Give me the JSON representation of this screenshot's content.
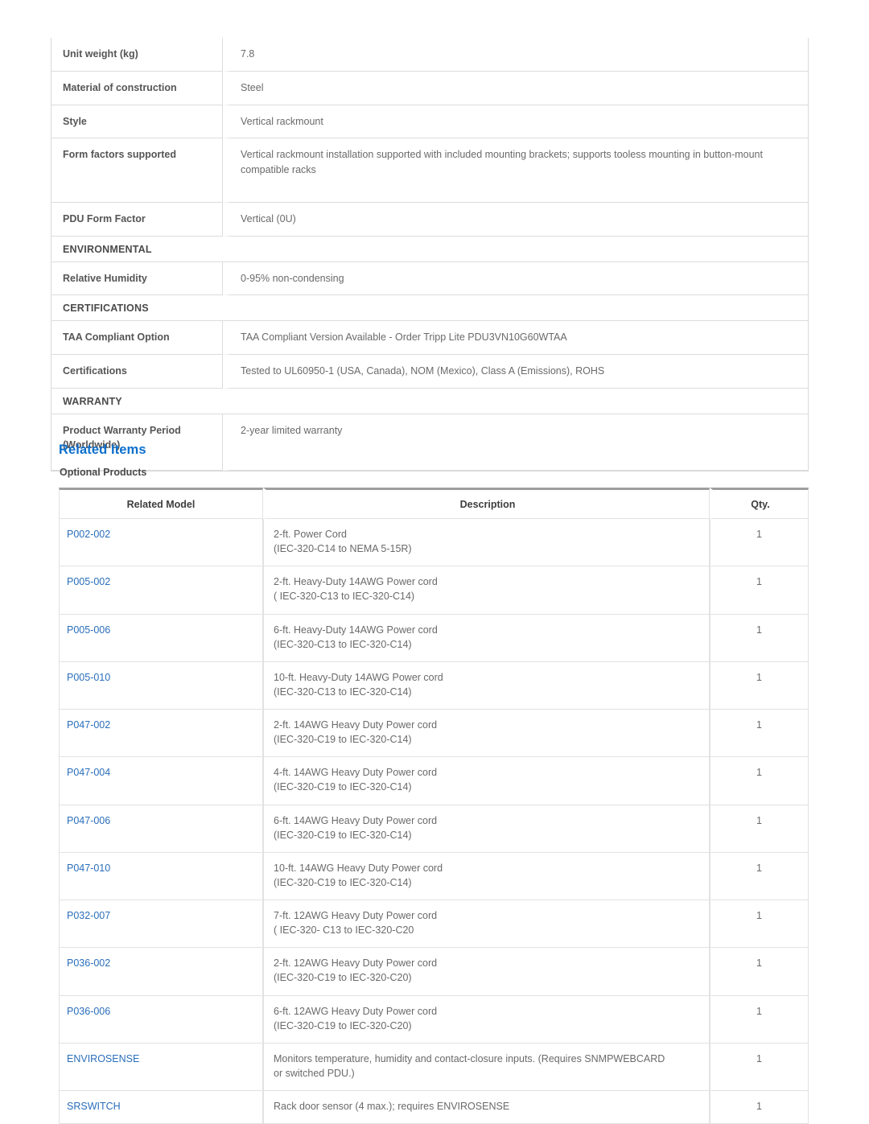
{
  "spec_table": {
    "rows": [
      {
        "type": "kv",
        "key": "Unit weight (kg)",
        "value": "7.8"
      },
      {
        "type": "kv",
        "key": "Material of construction",
        "value": "Steel"
      },
      {
        "type": "kv",
        "key": "Style",
        "value": "Vertical rackmount"
      },
      {
        "type": "kv",
        "key": "Form factors supported",
        "value": "Vertical rackmount installation supported with included mounting brackets; supports tooless mounting in button-mount compatible racks"
      },
      {
        "type": "kv",
        "key": "PDU Form Factor",
        "value": "Vertical (0U)"
      },
      {
        "type": "section",
        "key": "ENVIRONMENTAL"
      },
      {
        "type": "kv",
        "key": "Relative Humidity",
        "value": "0-95% non-condensing"
      },
      {
        "type": "section",
        "key": "CERTIFICATIONS"
      },
      {
        "type": "kv",
        "key": "TAA Compliant Option",
        "value": "TAA Compliant Version Available - Order Tripp Lite PDU3VN10G60WTAA"
      },
      {
        "type": "kv",
        "key": "Certifications",
        "value": "Tested to UL60950-1 (USA, Canada), NOM (Mexico), Class A (Emissions), ROHS"
      },
      {
        "type": "section",
        "key": "WARRANTY"
      },
      {
        "type": "kv",
        "key": "Product Warranty Period (Worldwide)",
        "value": "2-year limited warranty"
      }
    ]
  },
  "related": {
    "heading": "Related Items",
    "subheading": "Optional Products",
    "columns": {
      "model": "Related Model",
      "description": "Description",
      "qty": "Qty."
    },
    "rows": [
      {
        "model": "P002-002",
        "desc1": "2-ft. Power Cord",
        "desc2": "(IEC-320-C14 to NEMA 5-15R)",
        "qty": "1"
      },
      {
        "model": "P005-002",
        "desc1": "2-ft. Heavy-Duty 14AWG Power cord",
        "desc2": "( IEC-320-C13 to IEC-320-C14)",
        "qty": "1"
      },
      {
        "model": "P005-006",
        "desc1": "6-ft. Heavy-Duty 14AWG Power cord",
        "desc2": "(IEC-320-C13 to IEC-320-C14)",
        "qty": "1"
      },
      {
        "model": "P005-010",
        "desc1": "10-ft. Heavy-Duty 14AWG Power cord",
        "desc2": "(IEC-320-C13 to IEC-320-C14)",
        "qty": "1"
      },
      {
        "model": "P047-002",
        "desc1": "2-ft. 14AWG Heavy Duty Power cord",
        "desc2": "(IEC-320-C19 to IEC-320-C14)",
        "qty": "1"
      },
      {
        "model": "P047-004",
        "desc1": "4-ft. 14AWG Heavy Duty Power cord",
        "desc2": "(IEC-320-C19 to IEC-320-C14)",
        "qty": "1"
      },
      {
        "model": "P047-006",
        "desc1": "6-ft. 14AWG Heavy Duty Power cord",
        "desc2": "(IEC-320-C19 to IEC-320-C14)",
        "qty": "1"
      },
      {
        "model": "P047-010",
        "desc1": "10-ft. 14AWG Heavy Duty Power cord",
        "desc2": "(IEC-320-C19 to IEC-320-C14)",
        "qty": "1"
      },
      {
        "model": "P032-007",
        "desc1": "7-ft. 12AWG Heavy Duty Power cord",
        "desc2": "( IEC-320- C13 to IEC-320-C20",
        "qty": "1"
      },
      {
        "model": "P036-002",
        "desc1": "2-ft. 12AWG Heavy Duty Power cord",
        "desc2": "(IEC-320-C19 to IEC-320-C20)",
        "qty": "1"
      },
      {
        "model": "P036-006",
        "desc1": "6-ft. 12AWG Heavy Duty Power cord",
        "desc2": "(IEC-320-C19 to IEC-320-C20)",
        "qty": "1"
      },
      {
        "model": "ENVIROSENSE",
        "desc1": "Monitors temperature, humidity and contact-closure inputs. (Requires SNMPWEBCARD",
        "desc2": "or switched PDU.)",
        "qty": "1"
      },
      {
        "model": "SRSWITCH",
        "desc1": "Rack door sensor (4 max.); requires ENVIROSENSE",
        "desc2": "",
        "qty": "1"
      }
    ]
  },
  "colors": {
    "heading_blue": "#0b6fcc",
    "link_blue": "#2a6ebb",
    "border": "#dcdcdc",
    "text": "#6a6a6a",
    "label_text": "#555555"
  }
}
